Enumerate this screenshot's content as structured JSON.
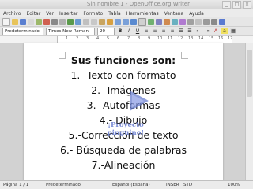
{
  "window": {
    "title": "Sin nombre 1 - OpenOffice.org Writer"
  },
  "menu": [
    "Archivo",
    "Editar",
    "Ver",
    "Insertar",
    "Formato",
    "Tabla",
    "Herramientas",
    "Ventana",
    "Ayuda"
  ],
  "format_bar": {
    "style": "Predeterminado",
    "font": "Times New Roman",
    "size": "20"
  },
  "ruler_numbers": [
    "1",
    "2",
    "3",
    "4",
    "5",
    "6",
    "7",
    "8",
    "9",
    "10",
    "11",
    "12",
    "13",
    "14",
    "15",
    "16",
    "17"
  ],
  "document": {
    "heading": "Sus funciones son:",
    "lines": [
      "1.- Texto con formato",
      "2.- Imágenes",
      "3.- Autoformas",
      "4.- Dibujo",
      "5.-Corrección de texto",
      "6.- Búsqueda de palabras",
      "7.-Alineación"
    ]
  },
  "watermark": {
    "caption": "¡Proyecto pinguino!"
  },
  "status": {
    "page": "Página 1 / 1",
    "style": "Predeterminado",
    "language": "Español (España)",
    "insert": "INSER",
    "std": "STD",
    "zoom": "100%"
  },
  "colors": {
    "accent": "#6b7fd0",
    "workspace": "#d2d2d2"
  }
}
